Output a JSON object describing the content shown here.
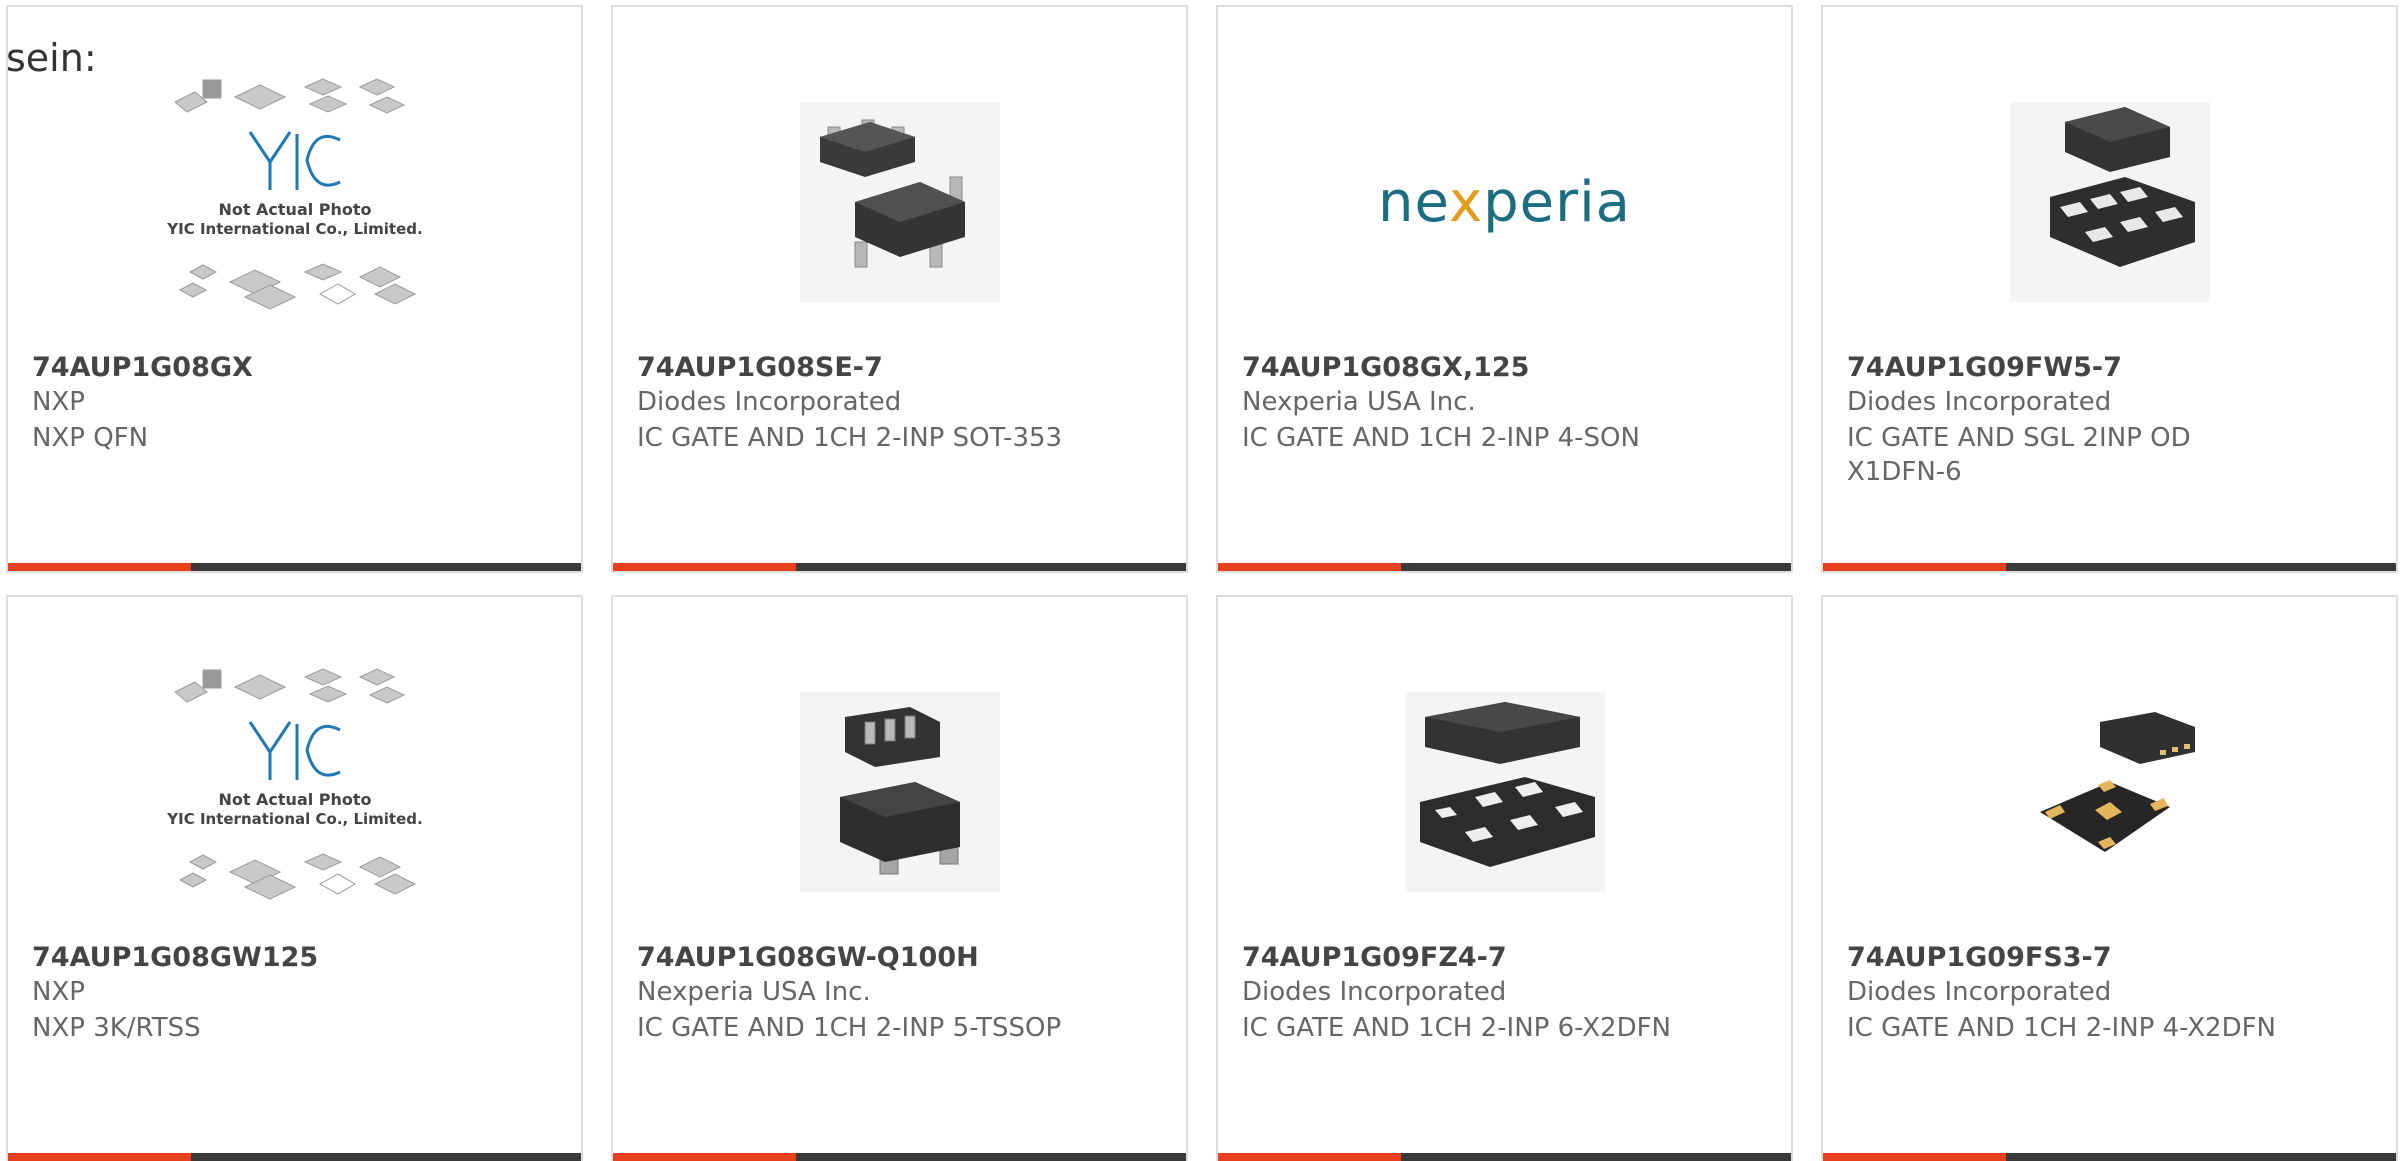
{
  "lead_text": "sein:",
  "colors": {
    "accent": "#e8401c",
    "bar": "#3a3a3a",
    "card_border": "#dddddd",
    "nexperia_teal": "#1b6e82",
    "nexperia_orange": "#e59a1a"
  },
  "placeholder_image": {
    "logo": "YIC",
    "line1": "Not Actual Photo",
    "line2": "YIC International Co., Limited."
  },
  "nexperia_logo": {
    "pre": "ne",
    "x": "x",
    "post": "peria"
  },
  "products": [
    {
      "part": "74AUP1G08GX",
      "maker": "NXP",
      "desc": "NXP QFN",
      "image": "placeholder"
    },
    {
      "part": "74AUP1G08SE-7",
      "maker": "Diodes Incorporated",
      "desc": "IC GATE AND 1CH 2-INP SOT-353",
      "image": "sot353-package"
    },
    {
      "part": "74AUP1G08GX,125",
      "maker": "Nexperia USA Inc.",
      "desc": "IC GATE AND 1CH 2-INP 4-SON",
      "image": "nexperia-logo"
    },
    {
      "part": "74AUP1G09FW5-7",
      "maker": "Diodes Incorporated",
      "desc": "IC GATE AND SGL 2INP OD X1DFN-6",
      "image": "x1dfn-package"
    },
    {
      "part": "74AUP1G08GW125",
      "maker": "NXP",
      "desc": "NXP 3K/RTSS",
      "image": "placeholder"
    },
    {
      "part": "74AUP1G08GW-Q100H",
      "maker": "Nexperia USA Inc.",
      "desc": "IC GATE AND 1CH 2-INP 5-TSSOP",
      "image": "tssop-package"
    },
    {
      "part": "74AUP1G09FZ4-7",
      "maker": "Diodes Incorporated",
      "desc": "IC GATE AND 1CH 2-INP 6-X2DFN",
      "image": "x2dfn6-package"
    },
    {
      "part": "74AUP1G09FS3-7",
      "maker": "Diodes Incorporated",
      "desc": "IC GATE AND 1CH 2-INP 4-X2DFN",
      "image": "x2dfn4-package"
    }
  ]
}
